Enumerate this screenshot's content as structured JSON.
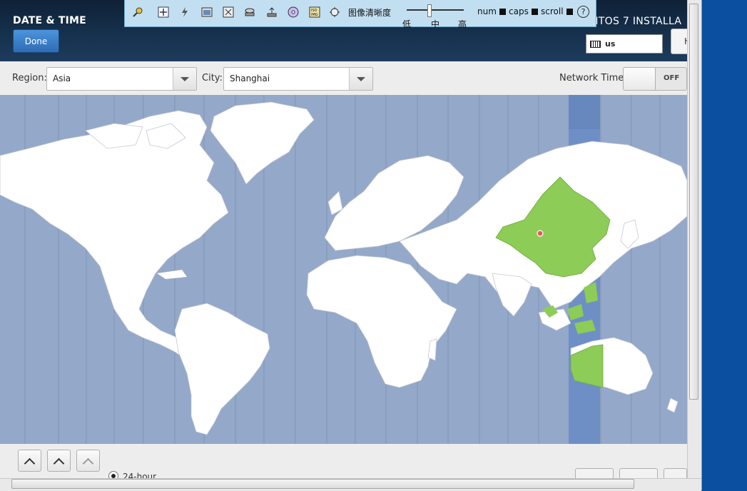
{
  "header": {
    "title": "DATE & TIME",
    "done_label": "Done",
    "installer_title": "NTOS 7 INSTALLA",
    "keyboard_layout": "us",
    "help_label": "H"
  },
  "console_toolbar": {
    "quality_label": "图像清晰度",
    "levels": [
      "低",
      "中",
      "高"
    ],
    "indicators": [
      "num",
      "caps",
      "scroll"
    ],
    "help_symbol": "?"
  },
  "filters": {
    "region_label": "Region:",
    "region_value": "Asia",
    "city_label": "City:",
    "city_value": "Shanghai",
    "network_time_label": "Network Time",
    "network_time_state": "OFF"
  },
  "time_format": {
    "selected_option": "24-hour"
  },
  "colors": {
    "ocean": "#94a8c9",
    "highlight_zone": "#6e8fc6",
    "land": "#ffffff",
    "selected_country": "#8dcc57",
    "header_bg": "#17324f",
    "done_button": "#3a7cc4"
  }
}
